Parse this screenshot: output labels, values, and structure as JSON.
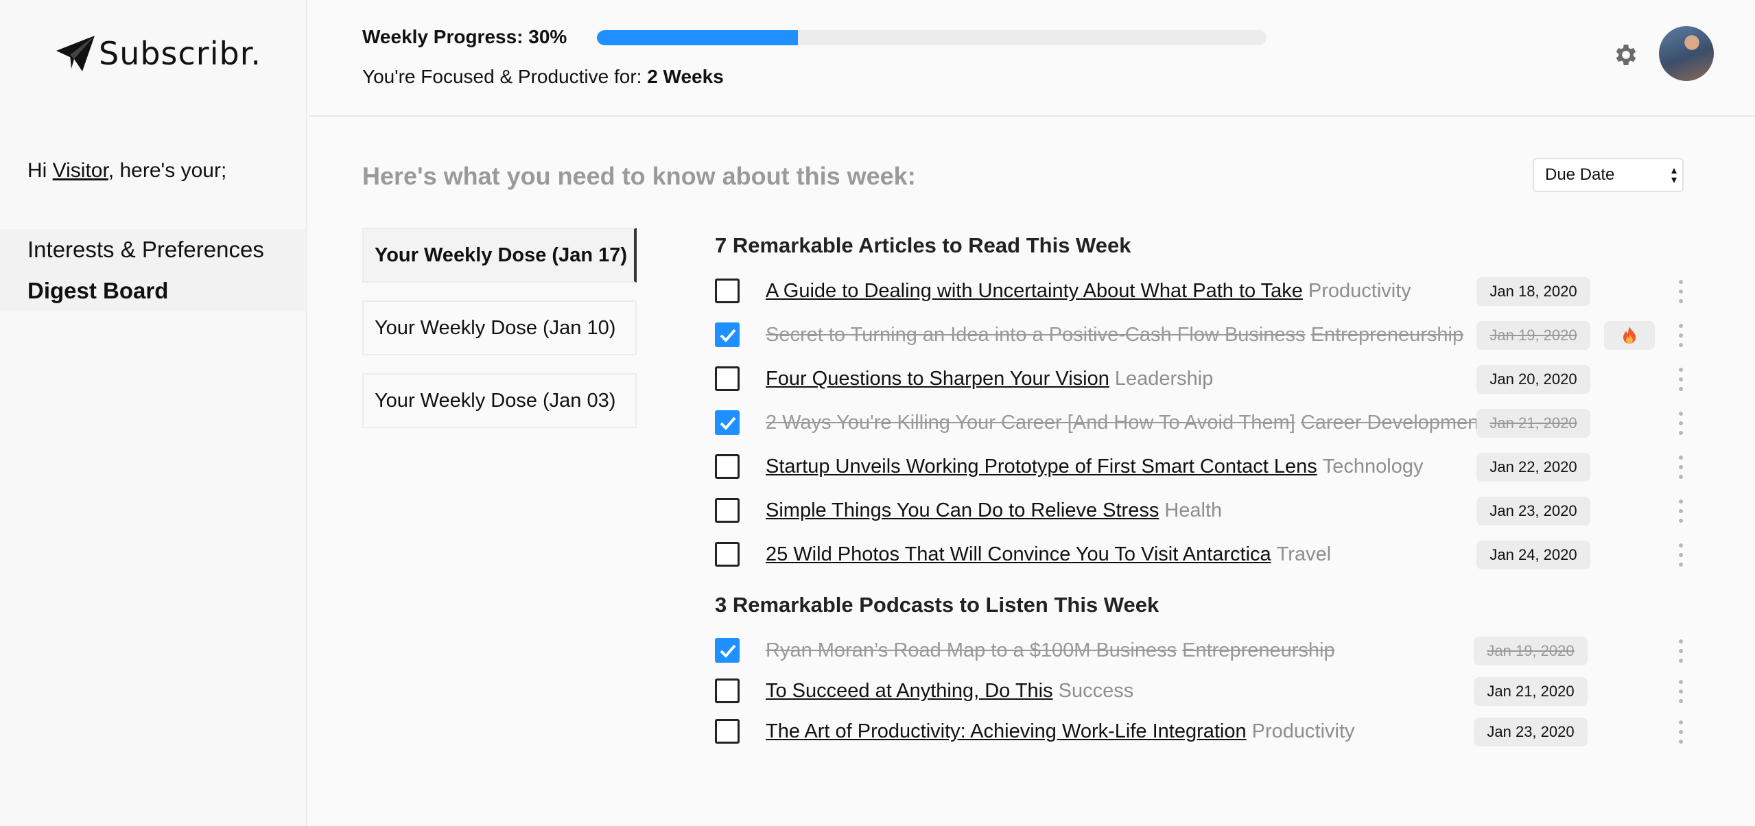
{
  "app": {
    "logo_text": "Subscribr."
  },
  "sidebar": {
    "greeting_prefix": "Hi ",
    "visitor_name": "Visitor",
    "greeting_suffix": ", here's your;",
    "items": [
      {
        "label": "Interests & Preferences"
      },
      {
        "label": "Digest Board"
      }
    ]
  },
  "header": {
    "progress_label": "Weekly Progress: 30%",
    "progress_value": 0.3,
    "focus_prefix": "You're Focused & Productive for: ",
    "focus_value": "2 Weeks",
    "accent": "#1e90ff"
  },
  "main": {
    "heading": "Here's what you need to know about this week:",
    "sort": {
      "selected": "Due Date"
    },
    "weeks": [
      {
        "label": "Your Weekly Dose (Jan 17)"
      },
      {
        "label": "Your Weekly Dose (Jan 10)"
      },
      {
        "label": "Your Weekly Dose (Jan 03)"
      }
    ],
    "articles_title": "7 Remarkable Articles to Read This Week",
    "articles": [
      {
        "title": "A Guide to Dealing with Uncertainty About What Path to Take",
        "category": "Productivity",
        "date": "Jan 18, 2020",
        "done": false
      },
      {
        "title": "Secret to Turning an Idea into a Positive-Cash Flow Business",
        "category": "Entrepreneurship",
        "date": "Jan 19, 2020",
        "done": true,
        "hot": true
      },
      {
        "title": "Four Questions to Sharpen Your Vision",
        "category": "Leadership",
        "date": "Jan 20, 2020",
        "done": false
      },
      {
        "title": "2 Ways You're Killing Your Career [And How To Avoid Them]",
        "category": "Career Development",
        "date": "Jan 21, 2020",
        "done": true
      },
      {
        "title": "Startup Unveils Working Prototype of First Smart Contact Lens",
        "category": "Technology",
        "date": "Jan 22, 2020",
        "done": false
      },
      {
        "title": "Simple Things You Can Do to Relieve Stress",
        "category": "Health",
        "date": "Jan 23, 2020",
        "done": false
      },
      {
        "title": "25 Wild Photos That Will Convince You To Visit Antarctica",
        "category": "Travel",
        "date": "Jan 24, 2020",
        "done": false
      }
    ],
    "podcasts_title": "3 Remarkable Podcasts to Listen This Week",
    "podcasts": [
      {
        "title": "Ryan Moran’s Road Map to a $100M Business",
        "category": "Entrepreneurship",
        "date": "Jan 19, 2020",
        "done": true
      },
      {
        "title": "To Succeed at Anything, Do This",
        "category": "Success",
        "date": "Jan 21, 2020",
        "done": false
      },
      {
        "title": "The Art of Productivity: Achieving Work-Life Integration",
        "category": "Productivity",
        "date": "Jan 23, 2020",
        "done": false
      }
    ]
  }
}
